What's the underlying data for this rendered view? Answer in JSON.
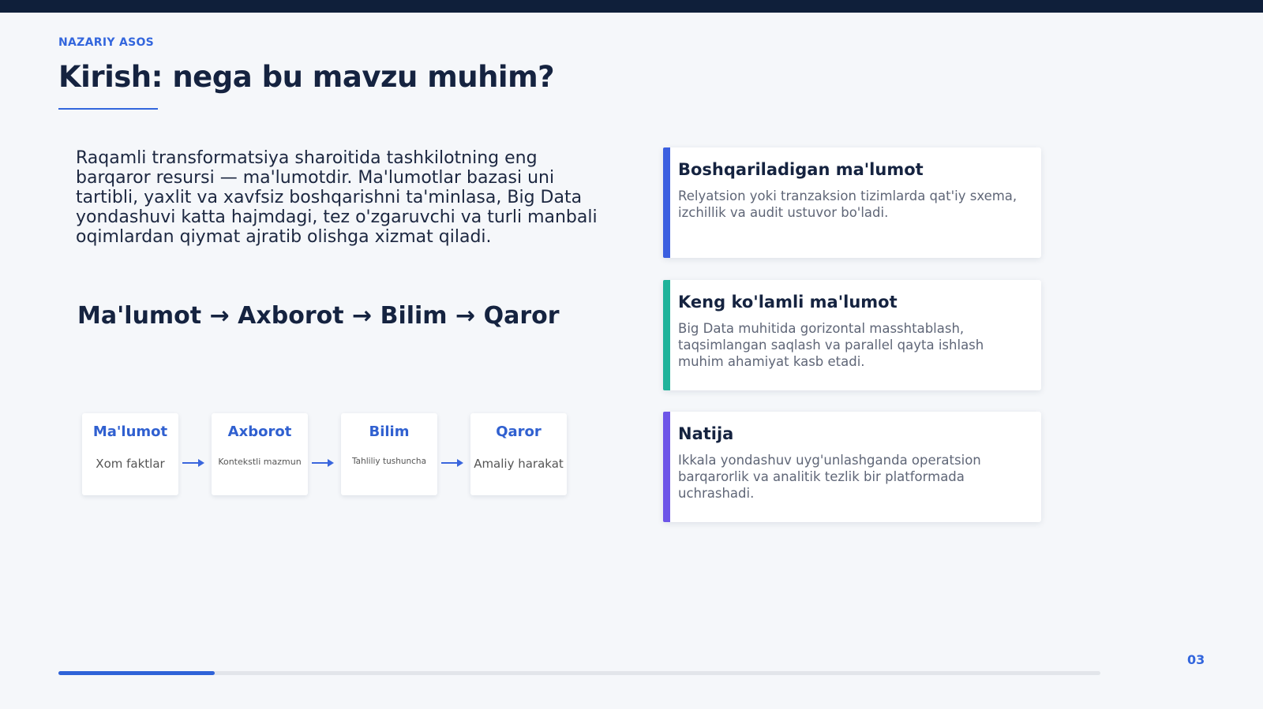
{
  "slide": {
    "eyebrow": "NAZARIY ASOS",
    "title": "Kirish: nega bu mavzu muhim?",
    "intro": "Raqamli transformatsiya sharoitida tashkilotning eng barqaror resursi — ma'lumotdir. Ma'lumotlar bazasi uni tartibli, yaxlit va xavfsiz boshqarishni ta'minlasa, Big Data yondashuvi katta hajmdagi, tez o'zgaruvchi va turli manbali oqimlardan qiymat ajratib olishga xizmat qiladi.",
    "chain": "Ma'lumot → Axborot → Bilim → Qaror",
    "page_number": "03",
    "progress_fraction": 0.15
  },
  "flow": [
    {
      "title": "Ma'lumot",
      "subtitle": "Xom faktlar"
    },
    {
      "title": "Axborot",
      "subtitle": "Kontekstli mazmun"
    },
    {
      "title": "Bilim",
      "subtitle": "Tahliliy tushuncha"
    },
    {
      "title": "Qaror",
      "subtitle": "Amaliy harakat"
    }
  ],
  "cards": [
    {
      "title": "Boshqariladigan ma'lumot",
      "body": "Relyatsion yoki tranzaksion tizimlarda qat'iy sxema, izchillik va audit ustuvor bo'ladi.",
      "accent": "#3b5fe0"
    },
    {
      "title": "Keng ko'lamli ma'lumot",
      "body": "Big Data muhitida gorizontal masshtablash, taqsimlangan saqlash va parallel qayta ishlash muhim ahamiyat kasb etadi.",
      "accent": "#1fb39a"
    },
    {
      "title": "Natija",
      "body": "Ikkala yondashuv uyg'unlashganda operatsion barqarorlik va analitik tezlik bir platformada uchrashadi.",
      "accent": "#6d55e8"
    }
  ],
  "colors": {
    "topbar": "#0f1f3a",
    "brand_blue": "#3366dd",
    "arrow": "#3a66dd"
  }
}
